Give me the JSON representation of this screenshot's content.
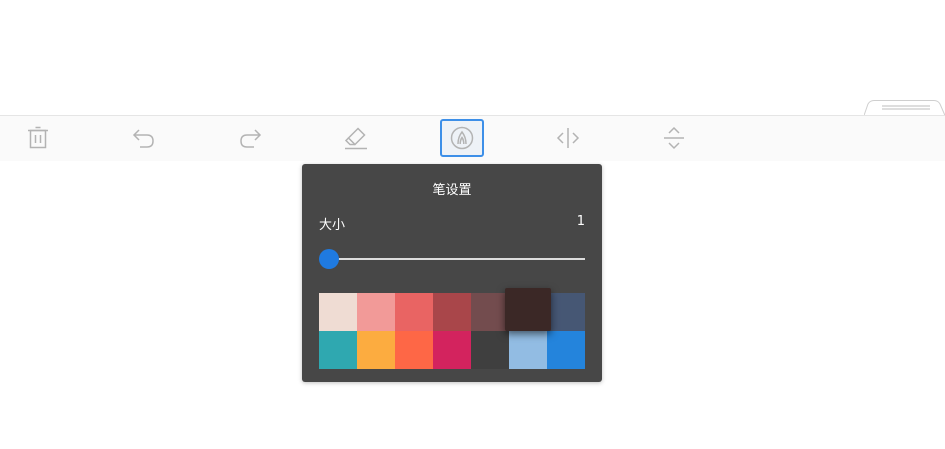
{
  "toolbar": {
    "tools": [
      {
        "name": "clear",
        "icon": "trash-icon",
        "active": false
      },
      {
        "name": "undo",
        "icon": "undo-icon",
        "active": false
      },
      {
        "name": "redo",
        "icon": "redo-icon",
        "active": false
      },
      {
        "name": "eraser",
        "icon": "eraser-icon",
        "active": false
      },
      {
        "name": "pen",
        "icon": "pen-nib-icon",
        "active": true
      },
      {
        "name": "horizontal-resize",
        "icon": "horizontal-arrows-icon",
        "active": false
      },
      {
        "name": "vertical-resize",
        "icon": "vertical-arrows-icon",
        "active": false
      }
    ]
  },
  "pen_settings": {
    "title": "笔设置",
    "size_label": "大小",
    "size_value": "1",
    "slider_level": 0.0,
    "colors": [
      [
        "#efdcd3",
        "#f29a98",
        "#e96463",
        "#a9464a",
        "#734c4e",
        "#3b2826",
        "#465774"
      ],
      [
        "#2fa8b0",
        "#fcac40",
        "#fe6746",
        "#d3235e",
        "#3f3f3f",
        "#92bce3",
        "#2484dc"
      ]
    ],
    "selected_color": "#3b2826",
    "accent": "#1f7ae0"
  }
}
